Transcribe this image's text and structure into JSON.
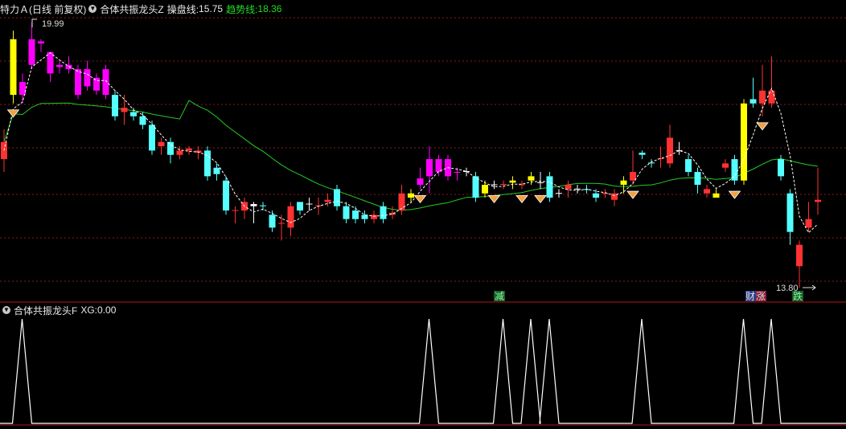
{
  "main_header": {
    "stock_name": "特力Ａ",
    "period": "(日线 前复权)",
    "indicator_name": "合体共振龙头Z",
    "operate_line_label": "操盘线:",
    "operate_line_value": "15.75",
    "trend_line_label": "趋势线:",
    "trend_line_value": "18.36"
  },
  "sub_header": {
    "indicator_name": "合体共振龙头F",
    "xg_label": "XG:",
    "xg_value": "0.00"
  },
  "annotations": {
    "high_price": "19.99",
    "low_price": "13.80",
    "signal_reduce": "减",
    "signal_fortune": "财",
    "signal_rise": "涨",
    "signal_fall": "跌"
  },
  "icons": [
    "chevron-down-icon",
    "diamond-icon"
  ],
  "colors": {
    "background": "#000000",
    "up_red": "#ff3232",
    "down_cyan": "#54ffff",
    "magenta": "#ff00ff",
    "yellow": "#ffff00",
    "trend_green": "#22cc22",
    "operate_dash": "#ffffff",
    "grid_red": "#8a1a1a"
  },
  "chart_data": [
    {
      "type": "candlestick",
      "title": "",
      "price_range": [
        13.8,
        19.99
      ],
      "candles": [
        {
          "o": 16.8,
          "c": 17.2,
          "h": 17.5,
          "l": 16.5,
          "color": "red"
        },
        {
          "o": 18.3,
          "c": 19.6,
          "h": 19.8,
          "l": 18.1,
          "color": "yellow"
        },
        {
          "o": 18.6,
          "c": 18.3,
          "h": 18.8,
          "l": 18.1,
          "color": "magenta"
        },
        {
          "o": 19.0,
          "c": 19.6,
          "h": 19.99,
          "l": 18.9,
          "color": "magenta"
        },
        {
          "o": 19.55,
          "c": 19.5,
          "h": 19.6,
          "l": 19.3,
          "color": "magenta"
        },
        {
          "o": 19.3,
          "c": 18.8,
          "h": 19.3,
          "l": 18.6,
          "color": "magenta"
        },
        {
          "o": 19.0,
          "c": 18.95,
          "h": 19.1,
          "l": 18.8,
          "color": "magenta"
        },
        {
          "o": 19.0,
          "c": 18.9,
          "h": 19.2,
          "l": 18.8,
          "color": "magenta"
        },
        {
          "o": 18.9,
          "c": 18.3,
          "h": 19.0,
          "l": 18.2,
          "color": "magenta"
        },
        {
          "o": 18.9,
          "c": 18.5,
          "h": 19.1,
          "l": 18.4,
          "color": "magenta"
        },
        {
          "o": 18.7,
          "c": 18.4,
          "h": 18.8,
          "l": 18.3,
          "color": "magenta"
        },
        {
          "o": 18.9,
          "c": 18.3,
          "h": 19.0,
          "l": 18.2,
          "color": "magenta"
        },
        {
          "o": 18.3,
          "c": 17.8,
          "h": 18.4,
          "l": 17.7,
          "color": "cyan"
        },
        {
          "o": 17.9,
          "c": 18.0,
          "h": 18.3,
          "l": 17.6,
          "color": "red"
        },
        {
          "o": 17.9,
          "c": 17.8,
          "h": 18.0,
          "l": 17.7,
          "color": "cyan"
        },
        {
          "o": 17.8,
          "c": 17.6,
          "h": 17.9,
          "l": 17.5,
          "color": "cyan"
        },
        {
          "o": 17.6,
          "c": 17.0,
          "h": 17.7,
          "l": 16.9,
          "color": "cyan"
        },
        {
          "o": 17.2,
          "c": 17.1,
          "h": 17.3,
          "l": 16.9,
          "color": "red"
        },
        {
          "o": 17.2,
          "c": 16.9,
          "h": 17.3,
          "l": 16.7,
          "color": "cyan"
        },
        {
          "o": 16.9,
          "c": 17.0,
          "h": 17.1,
          "l": 16.8,
          "color": "red"
        },
        {
          "o": 17.0,
          "c": 17.05,
          "h": 17.1,
          "l": 16.9,
          "color": "red"
        },
        {
          "o": 17.0,
          "c": 16.95,
          "h": 17.1,
          "l": 16.8,
          "color": "red"
        },
        {
          "o": 17.0,
          "c": 16.4,
          "h": 17.1,
          "l": 16.3,
          "color": "cyan"
        },
        {
          "o": 16.6,
          "c": 16.45,
          "h": 16.7,
          "l": 16.3,
          "color": "cyan"
        },
        {
          "o": 16.3,
          "c": 15.6,
          "h": 16.4,
          "l": 15.5,
          "color": "cyan"
        },
        {
          "o": 15.6,
          "c": 15.61,
          "h": 15.7,
          "l": 15.3,
          "color": "red"
        },
        {
          "o": 15.6,
          "c": 15.8,
          "h": 15.9,
          "l": 15.4,
          "color": "red"
        },
        {
          "o": 15.75,
          "c": 15.7,
          "h": 15.8,
          "l": 15.3,
          "color": "white"
        },
        {
          "o": 15.7,
          "c": 15.72,
          "h": 15.8,
          "l": 15.6,
          "color": "cyan"
        },
        {
          "o": 15.5,
          "c": 15.2,
          "h": 15.6,
          "l": 15.1,
          "color": "cyan"
        },
        {
          "o": 15.3,
          "c": 15.31,
          "h": 15.5,
          "l": 14.9,
          "color": "red"
        },
        {
          "o": 15.2,
          "c": 15.7,
          "h": 15.8,
          "l": 15.0,
          "color": "red"
        },
        {
          "o": 15.6,
          "c": 15.8,
          "h": 15.8,
          "l": 15.5,
          "color": "cyan"
        },
        {
          "o": 15.75,
          "c": 15.76,
          "h": 15.9,
          "l": 15.6,
          "color": "white"
        },
        {
          "o": 15.7,
          "c": 15.72,
          "h": 15.9,
          "l": 15.5,
          "color": "red"
        },
        {
          "o": 15.8,
          "c": 15.85,
          "h": 16.0,
          "l": 15.7,
          "color": "red"
        },
        {
          "o": 16.1,
          "c": 15.7,
          "h": 16.2,
          "l": 15.6,
          "color": "cyan"
        },
        {
          "o": 15.7,
          "c": 15.4,
          "h": 15.8,
          "l": 15.3,
          "color": "cyan"
        },
        {
          "o": 15.6,
          "c": 15.4,
          "h": 15.7,
          "l": 15.3,
          "color": "cyan"
        },
        {
          "o": 15.5,
          "c": 15.4,
          "h": 15.6,
          "l": 15.3,
          "color": "cyan"
        },
        {
          "o": 15.4,
          "c": 15.5,
          "h": 15.6,
          "l": 15.3,
          "color": "red"
        },
        {
          "o": 15.7,
          "c": 15.4,
          "h": 15.8,
          "l": 15.3,
          "color": "cyan"
        },
        {
          "o": 15.5,
          "c": 15.55,
          "h": 15.7,
          "l": 15.4,
          "color": "red"
        },
        {
          "o": 15.6,
          "c": 16.0,
          "h": 16.2,
          "l": 15.5,
          "color": "red"
        },
        {
          "o": 16.0,
          "c": 15.9,
          "h": 16.1,
          "l": 15.8,
          "color": "yellow"
        },
        {
          "o": 16.2,
          "c": 16.35,
          "h": 16.6,
          "l": 16.1,
          "color": "magenta"
        },
        {
          "o": 16.4,
          "c": 16.8,
          "h": 17.1,
          "l": 16.0,
          "color": "magenta"
        },
        {
          "o": 16.8,
          "c": 16.5,
          "h": 16.9,
          "l": 16.4,
          "color": "magenta"
        },
        {
          "o": 16.8,
          "c": 16.4,
          "h": 16.9,
          "l": 16.3,
          "color": "magenta"
        },
        {
          "o": 16.5,
          "c": 16.48,
          "h": 16.6,
          "l": 16.3,
          "color": "magenta"
        },
        {
          "o": 16.5,
          "c": 16.52,
          "h": 16.6,
          "l": 16.4,
          "color": "white"
        },
        {
          "o": 16.4,
          "c": 15.9,
          "h": 16.5,
          "l": 15.8,
          "color": "cyan"
        },
        {
          "o": 16.2,
          "c": 16.0,
          "h": 16.3,
          "l": 15.9,
          "color": "yellow"
        },
        {
          "o": 16.2,
          "c": 16.21,
          "h": 16.3,
          "l": 16.1,
          "color": "white"
        },
        {
          "o": 16.2,
          "c": 16.22,
          "h": 16.3,
          "l": 16.1,
          "color": "red"
        },
        {
          "o": 16.3,
          "c": 16.25,
          "h": 16.4,
          "l": 16.1,
          "color": "yellow"
        },
        {
          "o": 16.2,
          "c": 16.21,
          "h": 16.3,
          "l": 16.1,
          "color": "red"
        },
        {
          "o": 16.3,
          "c": 16.4,
          "h": 16.5,
          "l": 16.2,
          "color": "yellow"
        },
        {
          "o": 16.25,
          "c": 16.26,
          "h": 16.5,
          "l": 16.1,
          "color": "white"
        },
        {
          "o": 16.4,
          "c": 15.9,
          "h": 16.5,
          "l": 15.8,
          "color": "cyan"
        },
        {
          "o": 16.0,
          "c": 16.01,
          "h": 16.1,
          "l": 15.9,
          "color": "white"
        },
        {
          "o": 16.1,
          "c": 16.2,
          "h": 16.3,
          "l": 15.9,
          "color": "red"
        },
        {
          "o": 16.1,
          "c": 16.11,
          "h": 16.2,
          "l": 16.0,
          "color": "white"
        },
        {
          "o": 16.1,
          "c": 16.08,
          "h": 16.2,
          "l": 16.0,
          "color": "cyan"
        },
        {
          "o": 16.0,
          "c": 15.9,
          "h": 16.1,
          "l": 15.8,
          "color": "cyan"
        },
        {
          "o": 16.0,
          "c": 16.01,
          "h": 16.1,
          "l": 15.9,
          "color": "red"
        },
        {
          "o": 16.0,
          "c": 15.85,
          "h": 16.1,
          "l": 15.7,
          "color": "red"
        },
        {
          "o": 16.2,
          "c": 16.3,
          "h": 16.4,
          "l": 16.0,
          "color": "yellow"
        },
        {
          "o": 16.3,
          "c": 16.5,
          "h": 17.0,
          "l": 16.2,
          "color": "red"
        },
        {
          "o": 16.9,
          "c": 16.95,
          "h": 17.0,
          "l": 16.8,
          "color": "cyan"
        },
        {
          "o": 16.7,
          "c": 16.72,
          "h": 16.8,
          "l": 16.6,
          "color": "cyan"
        },
        {
          "o": 16.8,
          "c": 16.82,
          "h": 17.1,
          "l": 16.6,
          "color": "red"
        },
        {
          "o": 16.7,
          "c": 17.3,
          "h": 17.6,
          "l": 16.6,
          "color": "red"
        },
        {
          "o": 17.0,
          "c": 17.01,
          "h": 17.2,
          "l": 16.9,
          "color": "white"
        },
        {
          "o": 16.8,
          "c": 16.5,
          "h": 16.9,
          "l": 16.4,
          "color": "cyan"
        },
        {
          "o": 16.5,
          "c": 16.2,
          "h": 16.6,
          "l": 16.0,
          "color": "cyan"
        },
        {
          "o": 16.1,
          "c": 16.0,
          "h": 16.2,
          "l": 15.9,
          "color": "red"
        },
        {
          "o": 16.0,
          "c": 15.9,
          "h": 16.1,
          "l": 15.9,
          "color": "yellow"
        },
        {
          "o": 16.6,
          "c": 16.7,
          "h": 16.8,
          "l": 16.5,
          "color": "red"
        },
        {
          "o": 16.8,
          "c": 16.3,
          "h": 16.9,
          "l": 16.2,
          "color": "cyan"
        },
        {
          "o": 16.3,
          "c": 18.1,
          "h": 18.2,
          "l": 16.2,
          "color": "yellow"
        },
        {
          "o": 18.2,
          "c": 18.1,
          "h": 18.7,
          "l": 18.0,
          "color": "cyan"
        },
        {
          "o": 18.1,
          "c": 18.4,
          "h": 19.0,
          "l": 17.8,
          "color": "red"
        },
        {
          "o": 18.4,
          "c": 18.1,
          "h": 19.2,
          "l": 18.0,
          "color": "red"
        },
        {
          "o": 16.8,
          "c": 16.4,
          "h": 16.9,
          "l": 16.3,
          "color": "cyan"
        },
        {
          "o": 16.0,
          "c": 15.1,
          "h": 16.1,
          "l": 14.8,
          "color": "cyan"
        },
        {
          "o": 14.3,
          "c": 14.8,
          "h": 14.9,
          "l": 13.8,
          "color": "red"
        },
        {
          "o": 15.2,
          "c": 15.4,
          "h": 15.8,
          "l": 15.1,
          "color": "red"
        },
        {
          "o": 15.8,
          "c": 15.85,
          "h": 16.6,
          "l": 15.5,
          "color": "red"
        }
      ],
      "signals": [
        "减",
        "财",
        "涨",
        "跌"
      ]
    },
    {
      "type": "line",
      "title": "合体共振龙头F",
      "xg": [
        1,
        0,
        0,
        0,
        0,
        0,
        0,
        0,
        0,
        0,
        0,
        0,
        0,
        0,
        0,
        0,
        0,
        0,
        0,
        0,
        0,
        0,
        0,
        0,
        0,
        0,
        0,
        0,
        0,
        0,
        0,
        0,
        0,
        0,
        0,
        0,
        0,
        0,
        0,
        0,
        0,
        0,
        0,
        0,
        1,
        0,
        0,
        0,
        0,
        0,
        0,
        0,
        0,
        0,
        0,
        0,
        0,
        0,
        0,
        0,
        0,
        0,
        0,
        0,
        0,
        0,
        1,
        0,
        0,
        0,
        0,
        0,
        0,
        0,
        0,
        0,
        0,
        0,
        0,
        0,
        0,
        0,
        0,
        0,
        0,
        0,
        0,
        0,
        0,
        0,
        0
      ],
      "xg_peak_positions_desc": "spikes at signal bars",
      "ylim": [
        0,
        1
      ]
    }
  ]
}
